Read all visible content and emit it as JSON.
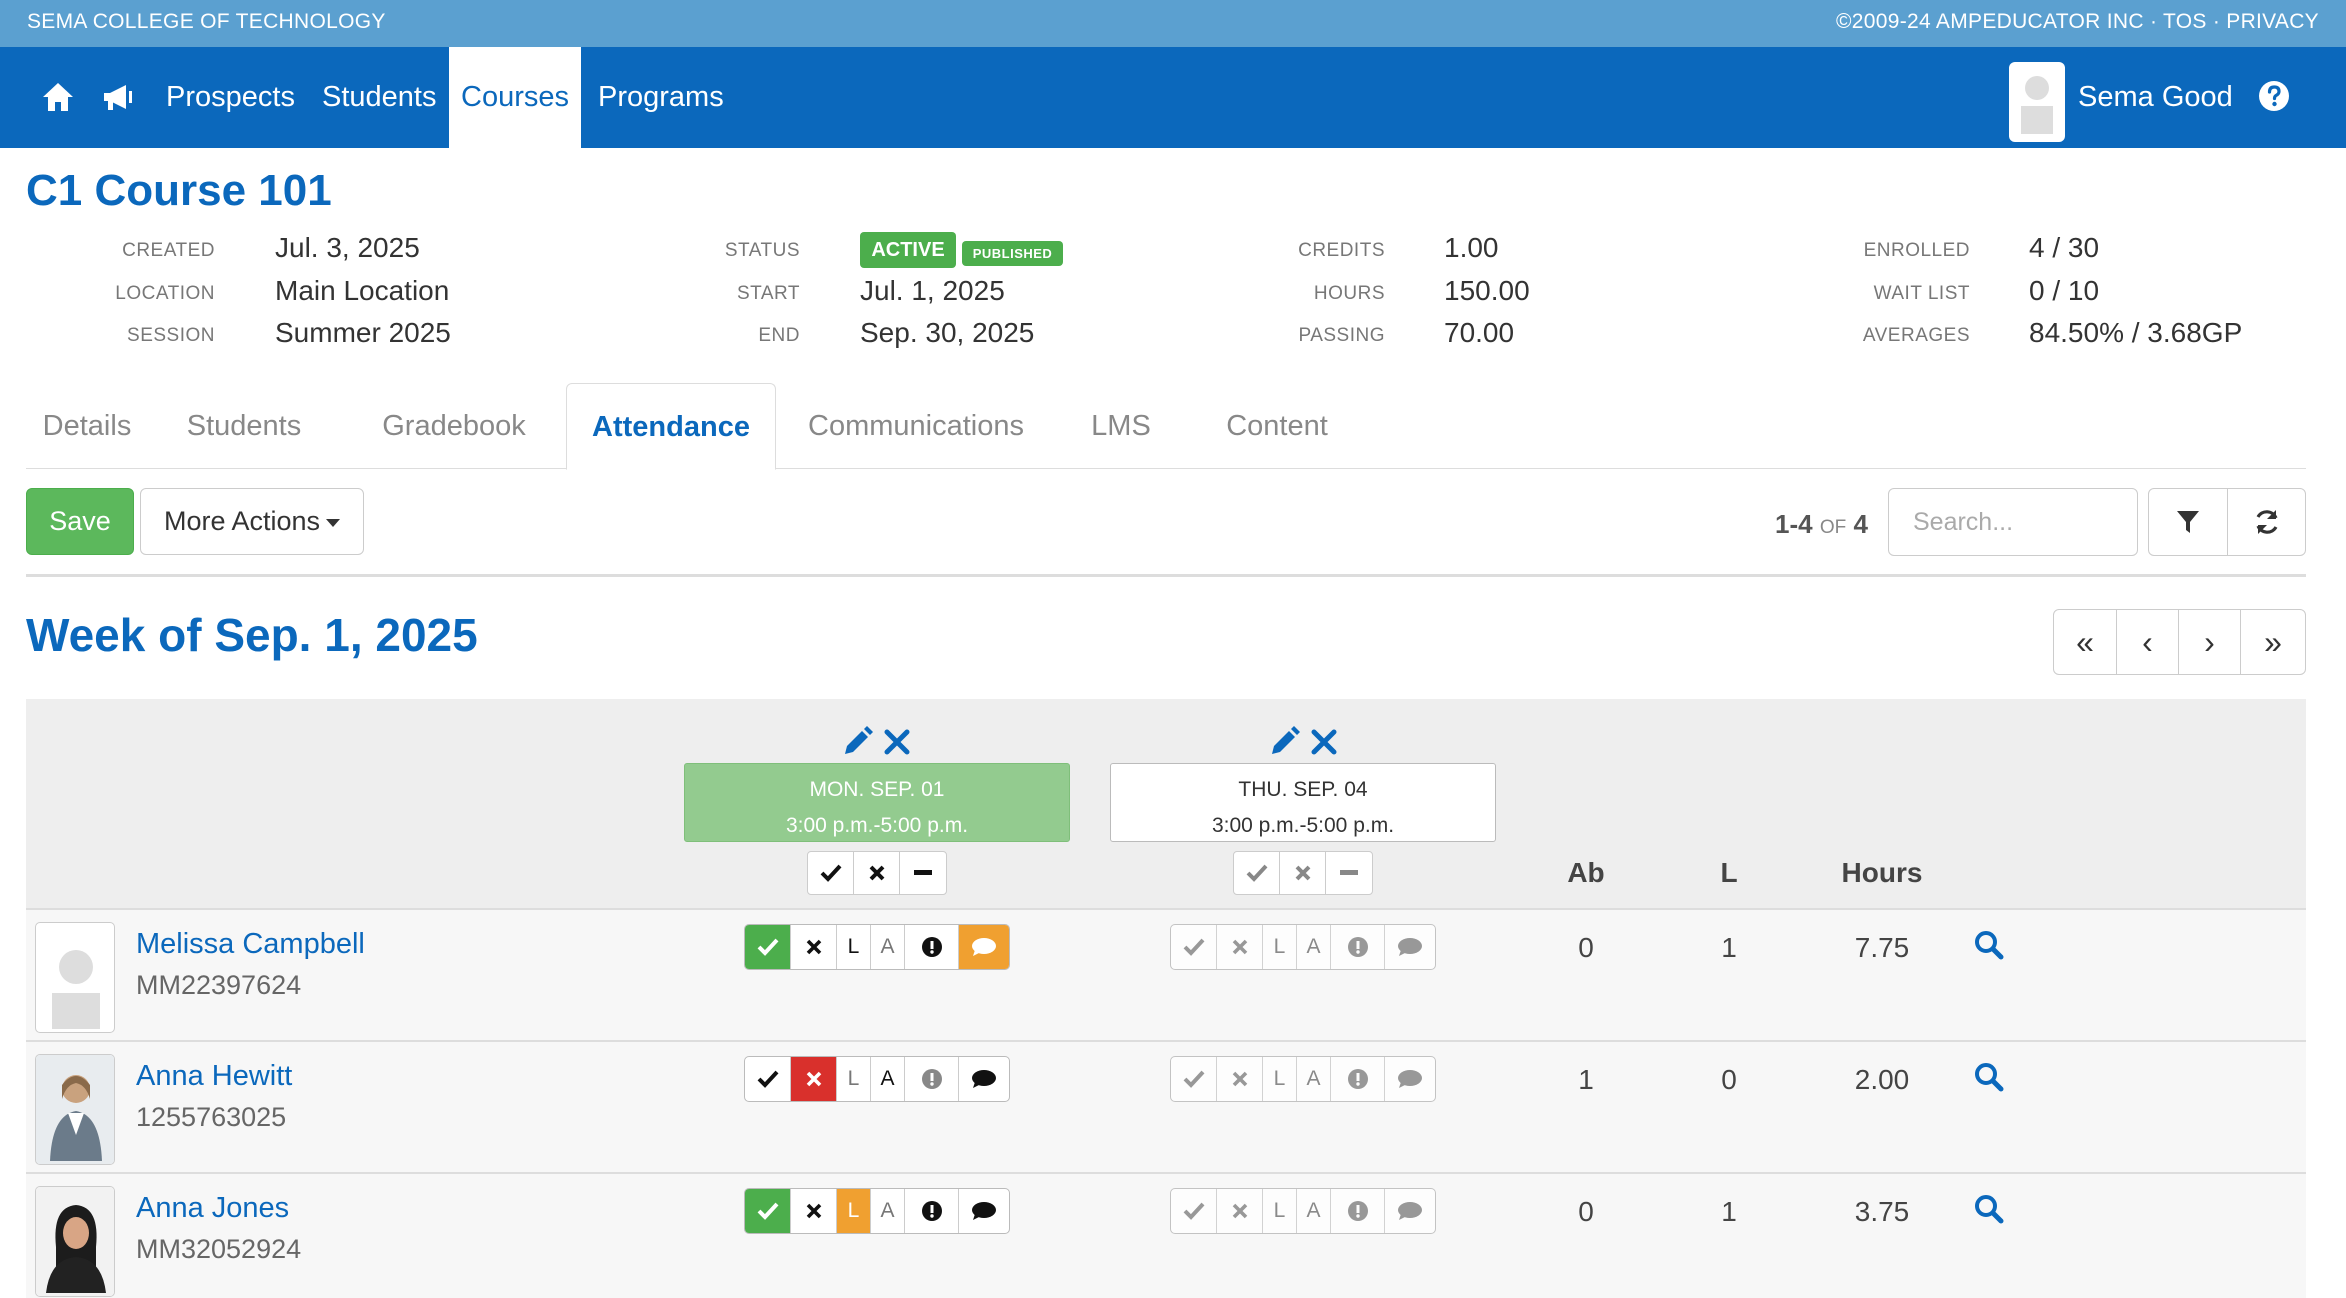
{
  "topbar": {
    "school": "SEMA COLLEGE OF TECHNOLOGY",
    "legal": "©2009-24 AMPEDUCATOR INC  ·  TOS  ·  PRIVACY"
  },
  "nav": {
    "links": [
      "Prospects",
      "Students",
      "Courses",
      "Programs"
    ],
    "active": "Courses",
    "user": "Sema Good",
    "accent": "#0b68bc"
  },
  "course": {
    "title": "C1 Course 101",
    "created_label": "CREATED",
    "created": "Jul. 3, 2025",
    "location_label": "LOCATION",
    "location": "Main Location",
    "session_label": "SESSION",
    "session": "Summer 2025",
    "status_label": "STATUS",
    "status": "ACTIVE",
    "published": "PUBLISHED",
    "start_label": "START",
    "start": "Jul. 1, 2025",
    "end_label": "END",
    "end": "Sep. 30, 2025",
    "credits_label": "CREDITS",
    "credits": "1.00",
    "hours_label": "HOURS",
    "hours": "150.00",
    "passing_label": "PASSING",
    "passing": "70.00",
    "enrolled_label": "ENROLLED",
    "enrolled": "4 / 30",
    "waitlist_label": "WAIT LIST",
    "waitlist": "0 / 10",
    "averages_label": "AVERAGES",
    "averages": "84.50% / 3.68GP"
  },
  "tabs": [
    "Details",
    "Students",
    "Gradebook",
    "Attendance",
    "Communications",
    "LMS",
    "Content"
  ],
  "toolbar": {
    "save": "Save",
    "more_actions": "More Actions",
    "range": "1-4",
    "of": "OF",
    "total": "4",
    "search_placeholder": "Search..."
  },
  "week": {
    "title": "Week of Sep. 1, 2025"
  },
  "sessions": [
    {
      "day": "MON. SEP. 01",
      "time": "3:00 p.m.-5:00 p.m."
    },
    {
      "day": "THU. SEP. 04",
      "time": "3:00 p.m.-5:00 p.m."
    }
  ],
  "columns": {
    "ab": "Ab",
    "l": "L",
    "hours": "Hours"
  },
  "att_letters": {
    "late": "L",
    "absent": "A"
  },
  "students": [
    {
      "name": "Melissa Campbell",
      "id": "MM22397624",
      "ab": "0",
      "l": "1",
      "hours": "7.75"
    },
    {
      "name": "Anna Hewitt",
      "id": "1255763025",
      "ab": "1",
      "l": "0",
      "hours": "2.00"
    },
    {
      "name": "Anna Jones",
      "id": "MM32052924",
      "ab": "0",
      "l": "1",
      "hours": "3.75"
    }
  ],
  "colors": {
    "green": "#4cae4c",
    "red": "#d9302c",
    "orange": "#f0a030",
    "blue": "#0b68bc"
  }
}
